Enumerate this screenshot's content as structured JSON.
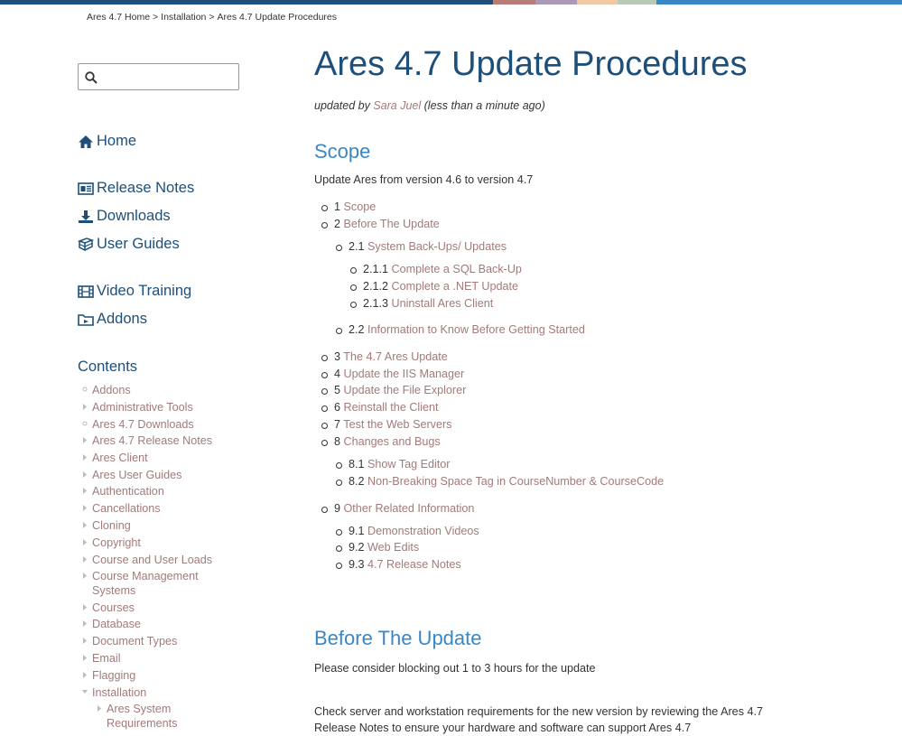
{
  "topbar_colors": [
    "#1d4f7a",
    "#b77d76",
    "#a99bb8",
    "#f1c8a4",
    "#b8c9b8",
    "#3a87c6"
  ],
  "breadcrumb": {
    "items": [
      "Ares 4.7 Home",
      "Installation",
      "Ares 4.7 Update Procedures"
    ],
    "separator": ">"
  },
  "search": {
    "placeholder": "",
    "value": ""
  },
  "nav": [
    {
      "label": "Home",
      "icon": "home-icon"
    },
    {
      "label": "Release Notes",
      "icon": "newspaper-icon"
    },
    {
      "label": "Downloads",
      "icon": "download-icon"
    },
    {
      "label": "User Guides",
      "icon": "book-icon"
    },
    {
      "label": "Video Training",
      "icon": "film-icon"
    },
    {
      "label": "Addons",
      "icon": "folder-plus-icon"
    }
  ],
  "contents": {
    "title": "Contents",
    "items": [
      {
        "label": "Addons",
        "marker": "circle"
      },
      {
        "label": "Administrative Tools",
        "marker": "triangle"
      },
      {
        "label": "Ares 4.7 Downloads",
        "marker": "circle"
      },
      {
        "label": "Ares 4.7 Release Notes",
        "marker": "triangle"
      },
      {
        "label": "Ares Client",
        "marker": "triangle"
      },
      {
        "label": "Ares User Guides",
        "marker": "triangle"
      },
      {
        "label": "Authentication",
        "marker": "triangle"
      },
      {
        "label": "Cancellations",
        "marker": "triangle"
      },
      {
        "label": "Cloning",
        "marker": "triangle"
      },
      {
        "label": "Copyright",
        "marker": "triangle"
      },
      {
        "label": "Course and User Loads",
        "marker": "triangle"
      },
      {
        "label": "Course Management Systems",
        "marker": "triangle"
      },
      {
        "label": "Courses",
        "marker": "triangle"
      },
      {
        "label": "Database",
        "marker": "triangle"
      },
      {
        "label": "Document Types",
        "marker": "triangle"
      },
      {
        "label": "Email",
        "marker": "triangle"
      },
      {
        "label": "Flagging",
        "marker": "triangle"
      },
      {
        "label": "Installation",
        "marker": "open"
      },
      {
        "label": "Ares System Requirements",
        "marker": "triangle"
      }
    ]
  },
  "main": {
    "title": "Ares 4.7 Update Procedures",
    "updated_prefix": "updated by",
    "author": "Sara Juel",
    "updated_suffix": "(less than a minute ago)",
    "scope_heading": "Scope",
    "scope_text": "Update Ares from version 4.6 to version 4.7",
    "toc": [
      {
        "num": "1",
        "label": "Scope"
      },
      {
        "num": "2",
        "label": "Before The Update"
      },
      {
        "num": "2.1",
        "label": "System Back-Ups/ Updates"
      },
      {
        "num": "2.1.1",
        "label": "Complete a SQL Back-Up"
      },
      {
        "num": "2.1.2",
        "label": "Complete a .NET Update"
      },
      {
        "num": "2.1.3",
        "label": "Uninstall Ares Client"
      },
      {
        "num": "2.2",
        "label": "Information to Know Before Getting Started"
      },
      {
        "num": "3",
        "label": "The 4.7 Ares Update"
      },
      {
        "num": "4",
        "label": "Update the IIS Manager"
      },
      {
        "num": "5",
        "label": "Update the File Explorer"
      },
      {
        "num": "6",
        "label": "Reinstall the Client"
      },
      {
        "num": "7",
        "label": "Test the Web Servers"
      },
      {
        "num": "8",
        "label": "Changes and Bugs"
      },
      {
        "num": "8.1",
        "label": "Show Tag Editor"
      },
      {
        "num": "8.2",
        "label": "Non-Breaking Space Tag in CourseNumber & CourseCode"
      },
      {
        "num": "9",
        "label": "Other Related Information"
      },
      {
        "num": "9.1",
        "label": "Demonstration Videos"
      },
      {
        "num": "9.2",
        "label": "Web Edits"
      },
      {
        "num": "9.3",
        "label": "4.7 Release Notes"
      }
    ],
    "before_heading": "Before The Update",
    "before_text1": "Please consider blocking out 1 to 3 hours for the update",
    "before_text2": "Check server and workstation requirements for the new version by reviewing the Ares 4.7 Release Notes to ensure your hardware and software can support Ares 4.7"
  }
}
